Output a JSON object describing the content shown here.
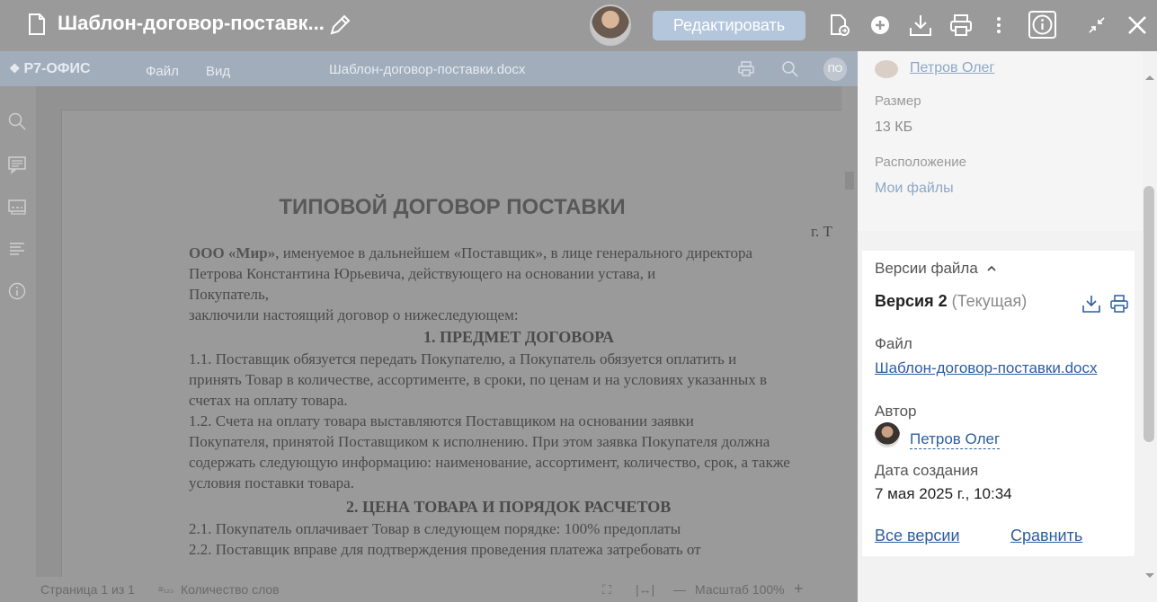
{
  "header": {
    "title": "Шаблон-договор-поставк...",
    "edit_button": "Редактировать",
    "icons": [
      "file-icon",
      "pencil-icon",
      "convert-icon",
      "plus-circle-icon",
      "download-icon",
      "print-icon",
      "more-icon",
      "info-icon",
      "collapse-icon",
      "close-icon"
    ]
  },
  "editor": {
    "brand": "Р7-ОФИС",
    "menu": [
      "Файл",
      "Вид"
    ],
    "filename": "Шаблон-договор-поставки.docx",
    "user_initials": "ПО",
    "document": {
      "title": "ТИПОВОЙ ДОГОВОР ПОСТАВКИ",
      "city": "г. Т",
      "lines": [
        "ООО «Мир», именуемое в дальнейшем «Поставщик», в лице генерального директора",
        "Петрова Константина Юрьевича, действующего на основании устава, и",
        "Покупатель,",
        "заключили настоящий договор о нижеследующем:"
      ],
      "section1": "1.      ПРЕДМЕТ ДОГОВОРА",
      "section1_lines": [
        "1.1.     Поставщик обязуется передать Покупателю, а Покупатель обязуется оплатить и",
        "принять Товар в количестве, ассортименте, в сроки, по ценам и на условиях указанных в",
        "счетах на оплату товара.",
        "1.2.     Счета на оплату товара выставляются Поставщиком на основании заявки",
        "Покупателя, принятой Поставщиком к исполнению. При этом заявка Покупателя должна",
        "содержать следующую информацию: наименование, ассортимент, количество, срок, а также",
        "условия поставки товара."
      ],
      "section2": "2.      ЦЕНА ТОВАРА И ПОРЯДОК РАСЧЕТОВ",
      "section2_lines": [
        "2.1.     Покупатель оплачивает Товар в следующем порядке: 100% предоплаты",
        "2.2.     Поставщик вправе для подтверждения проведения платежа затребовать от"
      ]
    },
    "status": {
      "page": "Страница 1 из 1",
      "word_count": "Количество слов",
      "zoom": "Масштаб 100%"
    }
  },
  "panel": {
    "owner": "Петров Олег",
    "size_label": "Размер",
    "size_value": "13 КБ",
    "location_label": "Расположение",
    "location_value": "Мои файлы",
    "versions_title": "Версии файла",
    "version_name": "Версия 2",
    "version_tag": "(Текущая)",
    "file_label": "Файл",
    "file_link": "Шаблон-договор-поставки.docx",
    "author_label": "Автор",
    "author_name": "Петров Олег",
    "created_label": "Дата создания",
    "created_value": "7 мая 2025 г., 10:34",
    "all_versions": "Все версии",
    "compare": "Сравнить"
  }
}
